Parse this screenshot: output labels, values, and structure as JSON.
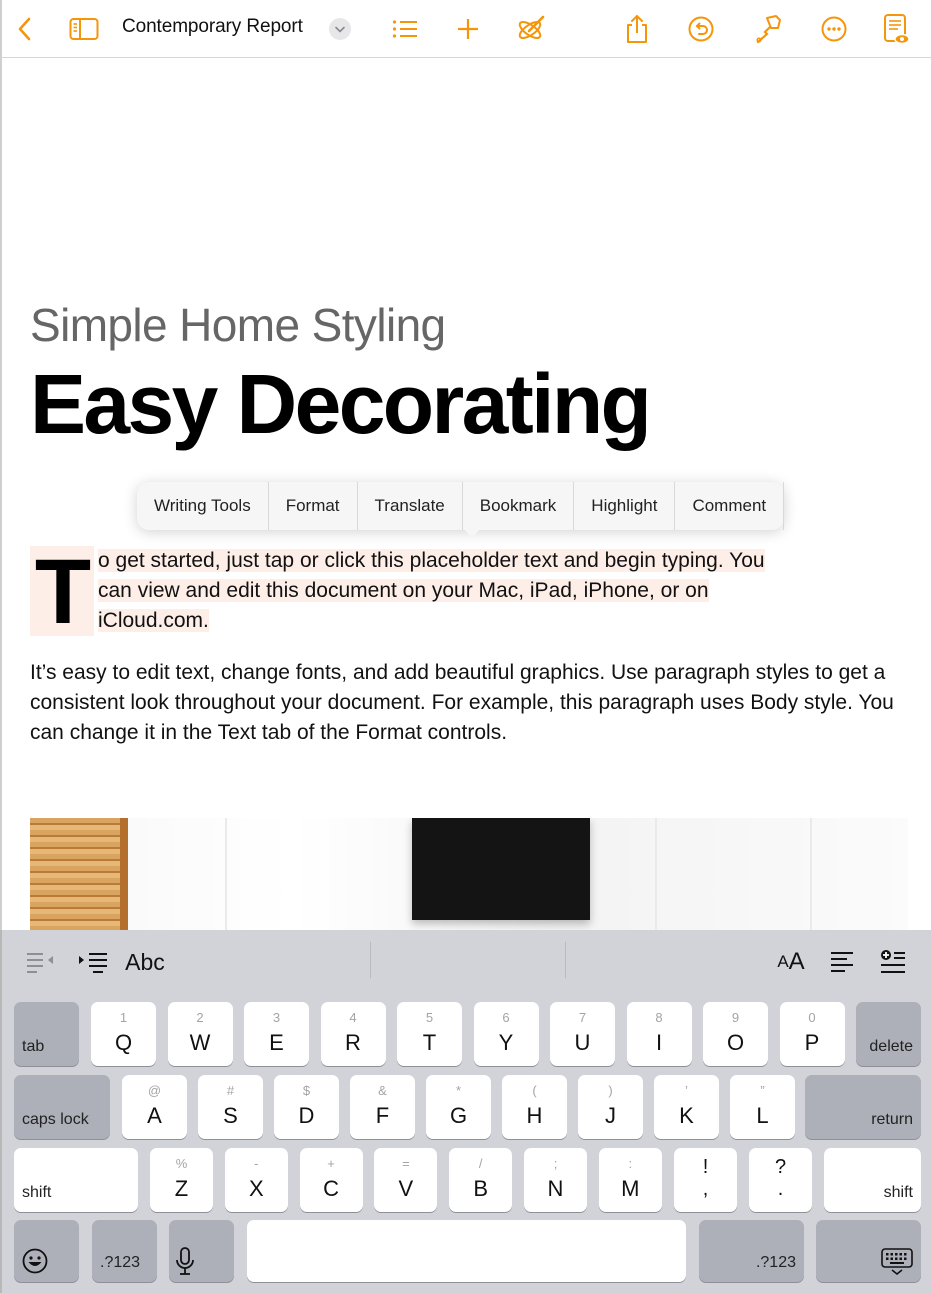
{
  "toolbar": {
    "document_title": "Contemporary Report",
    "icons": [
      "back-icon",
      "sidebar-icon",
      "title-menu-chevron-icon",
      "list-view-icon",
      "insert-icon",
      "writing-tools-icon",
      "share-icon",
      "undo-icon",
      "format-brush-icon",
      "more-icon",
      "reading-view-icon"
    ],
    "accent_color": "#f5960a"
  },
  "document": {
    "subtitle": "Simple Home Styling",
    "title": "Easy Decorating",
    "dropcap": "T",
    "paragraph1_lines": [
      "o get started, just tap or click this placeholder text and begin typing. You",
      "can view and edit this document on your Mac, iPad, iPhone, or on",
      "iCloud.com."
    ],
    "paragraph2": "It’s easy to edit text, change fonts, and add beautiful graphics. Use paragraph styles to get a consistent look throughout your document. For example, this paragraph uses Body style. You can change it in the Text tab of the Format controls.",
    "highlight_color": "#fdeee8"
  },
  "context_menu": {
    "items": [
      "Writing Tools",
      "Format",
      "Translate",
      "Bookmark",
      "Highlight",
      "Comment"
    ]
  },
  "shortcut_bar": {
    "outdent_icon": "outdent-icon",
    "indent_icon": "indent-icon",
    "style_label": "Abc",
    "font_size_label": "AA",
    "align_icon": "align-icon",
    "insert_icon": "insert-list-icon"
  },
  "keyboard": {
    "row1": [
      {
        "main": "Q",
        "alt": "1"
      },
      {
        "main": "W",
        "alt": "2"
      },
      {
        "main": "E",
        "alt": "3"
      },
      {
        "main": "R",
        "alt": "4"
      },
      {
        "main": "T",
        "alt": "5"
      },
      {
        "main": "Y",
        "alt": "6"
      },
      {
        "main": "U",
        "alt": "7"
      },
      {
        "main": "I",
        "alt": "8"
      },
      {
        "main": "O",
        "alt": "9"
      },
      {
        "main": "P",
        "alt": "0"
      }
    ],
    "row2": [
      {
        "main": "A",
        "alt": "@"
      },
      {
        "main": "S",
        "alt": "#"
      },
      {
        "main": "D",
        "alt": "$"
      },
      {
        "main": "F",
        "alt": "&"
      },
      {
        "main": "G",
        "alt": "*"
      },
      {
        "main": "H",
        "alt": "("
      },
      {
        "main": "J",
        "alt": ")"
      },
      {
        "main": "K",
        "alt": "’"
      },
      {
        "main": "L",
        "alt": "”"
      }
    ],
    "row3": [
      {
        "main": "Z",
        "alt": "%"
      },
      {
        "main": "X",
        "alt": "-"
      },
      {
        "main": "C",
        "alt": "+"
      },
      {
        "main": "V",
        "alt": "="
      },
      {
        "main": "B",
        "alt": "/"
      },
      {
        "main": "N",
        "alt": ";"
      },
      {
        "main": "M",
        "alt": ":"
      }
    ],
    "punct": [
      {
        "top": "!",
        "bottom": ","
      },
      {
        "top": "?",
        "bottom": "."
      }
    ],
    "tab": "tab",
    "delete": "delete",
    "caps_lock": "caps lock",
    "return": "return",
    "shift": "shift",
    "numbers": ".?123",
    "emoji_icon": "emoji-icon",
    "mic_icon": "microphone-icon",
    "dismiss_icon": "keyboard-dismiss-icon"
  }
}
